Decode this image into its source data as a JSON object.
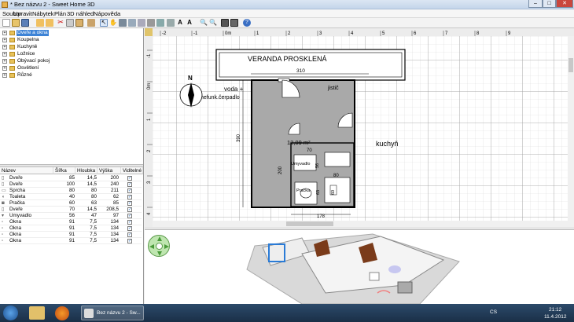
{
  "window": {
    "title": "* Bez názvu 2 - Sweet Home 3D",
    "min": "–",
    "max": "□",
    "close": "✕"
  },
  "menu": [
    "Soubor",
    "Upravit",
    "Nábytek",
    "Plán",
    "3D náhled",
    "Nápověda"
  ],
  "toolbar_icons": [
    "new-icon",
    "open-icon",
    "save-icon",
    "cut-icon",
    "undo-icon",
    "redo-icon",
    "delete-icon",
    "copy-icon",
    "paste-icon",
    "add-furniture-icon",
    "select-icon",
    "pan-icon",
    "create-walls-icon",
    "create-rooms-icon",
    "create-dimensions-icon",
    "add-text-icon",
    "zoom-in-icon",
    "zoom-out-icon",
    "create-photo-icon",
    "create-video-icon",
    "help-icon"
  ],
  "catalog": [
    {
      "label": "Dveře a okna",
      "selected": true
    },
    {
      "label": "Koupelna",
      "selected": false
    },
    {
      "label": "Kuchyně",
      "selected": false
    },
    {
      "label": "Ložnice",
      "selected": false
    },
    {
      "label": "Obývací pokoj",
      "selected": false
    },
    {
      "label": "Osvětlení",
      "selected": false
    },
    {
      "label": "Různé",
      "selected": false
    }
  ],
  "furniture_table": {
    "columns": [
      "Název",
      "Šířka",
      "Hloubka",
      "Výška",
      "Viditelné"
    ],
    "rows": [
      {
        "name": "Dveře",
        "width": "85",
        "depth": "14,5",
        "height": "200",
        "visible": true
      },
      {
        "name": "Dveře",
        "width": "100",
        "depth": "14,5",
        "height": "240",
        "visible": true
      },
      {
        "name": "Sprcha",
        "width": "80",
        "depth": "80",
        "height": "211",
        "visible": true
      },
      {
        "name": "Toaleta",
        "width": "40",
        "depth": "80",
        "height": "62",
        "visible": true
      },
      {
        "name": "Pračka",
        "width": "60",
        "depth": "63",
        "height": "85",
        "visible": true
      },
      {
        "name": "Dveře",
        "width": "70",
        "depth": "14,5",
        "height": "208,5",
        "visible": true
      },
      {
        "name": "Umyvadlo",
        "width": "56",
        "depth": "47",
        "height": "97",
        "visible": true
      },
      {
        "name": "Okna",
        "width": "91",
        "depth": "7,5",
        "height": "134",
        "visible": true
      },
      {
        "name": "Okna",
        "width": "91",
        "depth": "7,5",
        "height": "134",
        "visible": true
      },
      {
        "name": "Okna",
        "width": "91",
        "depth": "7,5",
        "height": "134",
        "visible": true
      },
      {
        "name": "Okna",
        "width": "91",
        "depth": "7,5",
        "height": "134",
        "visible": true
      }
    ]
  },
  "plan": {
    "ruler_top": [
      "-2",
      "-1",
      "0m",
      "1",
      "2",
      "3",
      "4",
      "5",
      "6",
      "7",
      "8",
      "9"
    ],
    "ruler_left": [
      "-1",
      "0m",
      "1",
      "2",
      "3",
      "4"
    ],
    "labels": {
      "veranda": "VERANDA PROSKLENÁ",
      "veranda_dim": "310",
      "voda": "voda +",
      "cerpadlo": "nefunk.čerpadlo",
      "jistic": "jistič",
      "area": "12,09 m²",
      "kuchyn": "kuchyň",
      "umyvadlo": "Umyvadlo",
      "pracka": "Pračka",
      "dim_390": "390",
      "dim_200": "200",
      "dim_70": "70",
      "dim_80": "80",
      "dim_80b": "80",
      "dim_178": "178",
      "dim_63": "63",
      "dim_60": "60",
      "dim_56": "56",
      "north": "N"
    }
  },
  "taskbar": {
    "task_label": "Bez názvu 2 - Sw...",
    "lang": "CS",
    "time": "21:12",
    "date": "11.4.2012"
  }
}
